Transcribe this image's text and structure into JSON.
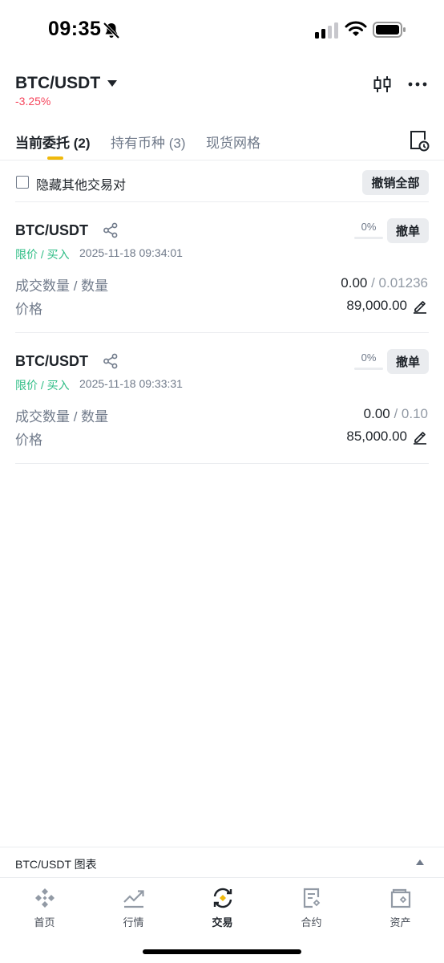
{
  "status_bar": {
    "time": "09:35"
  },
  "header": {
    "pair": "BTC/USDT",
    "change": "-3.25%"
  },
  "tabs": [
    {
      "label": "当前委托 (2)"
    },
    {
      "label": "持有币种 (3)"
    },
    {
      "label": "现货网格"
    }
  ],
  "filter": {
    "hide_others_label": "隐藏其他交易对",
    "cancel_all_label": "撤销全部"
  },
  "orders": [
    {
      "pair": "BTC/USDT",
      "type": "限价 / 买入",
      "time": "2025-11-18 09:34:01",
      "progress_label": "0%",
      "progress": 0,
      "cancel_label": "撤单",
      "filled_label": "成交数量 / 数量",
      "filled": "0.00",
      "sep": " / ",
      "amount": "0.01236",
      "price_label": "价格",
      "price": "89,000.00"
    },
    {
      "pair": "BTC/USDT",
      "type": "限价 / 买入",
      "time": "2025-11-18 09:33:31",
      "progress_label": "0%",
      "progress": 0,
      "cancel_label": "撤单",
      "filled_label": "成交数量 / 数量",
      "filled": "0.00",
      "sep": " / ",
      "amount": "0.10",
      "price_label": "价格",
      "price": "85,000.00"
    }
  ],
  "chart_bar": {
    "label": "BTC/USDT 图表"
  },
  "nav": [
    {
      "label": "首页",
      "icon": "home-icon"
    },
    {
      "label": "行情",
      "icon": "markets-icon"
    },
    {
      "label": "交易",
      "icon": "trade-icon"
    },
    {
      "label": "合约",
      "icon": "futures-icon"
    },
    {
      "label": "资产",
      "icon": "wallet-icon"
    }
  ],
  "colors": {
    "accent": "#f0b90b",
    "buy": "#2ebd85",
    "down": "#f6465d"
  }
}
